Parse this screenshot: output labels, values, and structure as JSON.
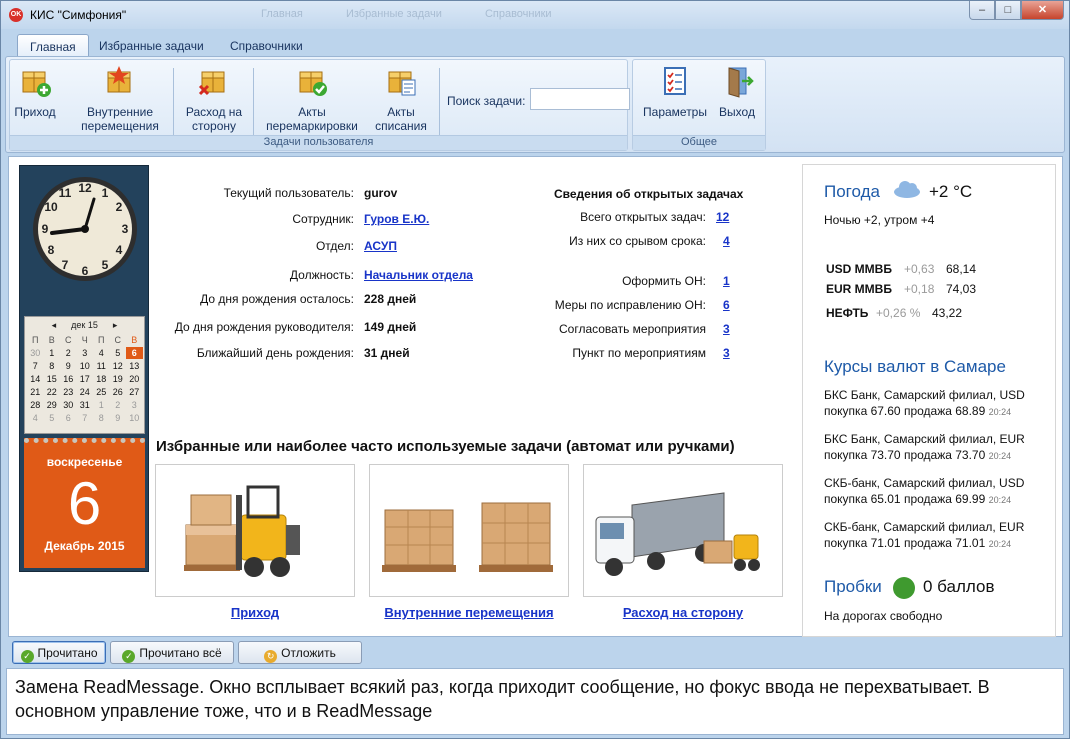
{
  "window": {
    "icon_text": "OK",
    "title": "КИС \"Симфония\"",
    "ghost_tabs": [
      "Главная",
      "Избранные задачи",
      "Справочники"
    ],
    "controls": {
      "minimize": "–",
      "maximize": "□",
      "close": "✕"
    }
  },
  "ribbon": {
    "tabs": [
      "Главная",
      "Избранные задачи",
      "Справочники"
    ],
    "buttons": {
      "income": [
        "Приход",
        ""
      ],
      "internal": [
        "Внутренние",
        "перемещения"
      ],
      "outgoing": [
        "Расход на",
        "сторону"
      ],
      "remark": [
        "Акты",
        "перемаркировки"
      ],
      "writeoff": [
        "Акты",
        "списания"
      ],
      "params": [
        "Параметры",
        ""
      ],
      "exit": [
        "Выход",
        ""
      ]
    },
    "search_label": "Поиск задачи:",
    "search_value": "",
    "group_user": "Задачи пользователя",
    "group_common": "Общее"
  },
  "calendar": {
    "month_label": "дек 15",
    "headers": [
      "П",
      "В",
      "С",
      "Ч",
      "П",
      "С",
      "В"
    ],
    "weeks": [
      [
        "30",
        "1",
        "2",
        "3",
        "4",
        "5",
        "6"
      ],
      [
        "7",
        "8",
        "9",
        "10",
        "11",
        "12",
        "13"
      ],
      [
        "14",
        "15",
        "16",
        "17",
        "18",
        "19",
        "20"
      ],
      [
        "21",
        "22",
        "23",
        "24",
        "25",
        "26",
        "27"
      ],
      [
        "28",
        "29",
        "30",
        "31",
        "1",
        "2",
        "3"
      ],
      [
        "4",
        "5",
        "6",
        "7",
        "8",
        "9",
        "10"
      ]
    ],
    "weekday": "воскресенье",
    "day": "6",
    "month_year": "Декабрь 2015"
  },
  "user_info": {
    "current_user_label": "Текущий пользователь:",
    "current_user": "gurov",
    "employee_label": "Сотрудник:",
    "employee": "Гуров Е.Ю.",
    "department_label": "Отдел:",
    "department": "АСУП",
    "position_label": "Должность:",
    "position": "Начальник отдела",
    "bday_label": "До дня рождения осталось:",
    "bday": "228 дней",
    "boss_bday_label": "До дня рождения руководителя:",
    "boss_bday": "149 дней",
    "next_bday_label": "Ближайший день рождения:",
    "next_bday": "31 дней"
  },
  "open_tasks": {
    "title": "Сведения об открытых задачах",
    "total_label": "Всего открытых задач:",
    "total": "12",
    "overdue_label": "Из них со срывом срока:",
    "overdue": "4",
    "on_label": "Оформить ОН:",
    "on": "1",
    "fix_label": "Меры по исправлению ОН:",
    "fix": "6",
    "agree_label": "Согласовать мероприятия",
    "agree": "3",
    "item_label": "Пункт по мероприятиям",
    "item": "3"
  },
  "favorites": {
    "title": "Избранные или наиболее часто используемые задачи (автомат или ручками)",
    "items": [
      "Приход",
      "Внутренние перемещения",
      "Расход на сторону"
    ]
  },
  "weather": {
    "title": "Погода",
    "temp": "+2 °C",
    "detail": "Ночью +2,  утром +4"
  },
  "stocks": [
    {
      "name": "USD ММВБ",
      "change": "+0,63",
      "value": "68,14"
    },
    {
      "name": "EUR ММВБ",
      "change": "+0,18",
      "value": "74,03"
    },
    {
      "name": "НЕФТЬ",
      "change": "+0,26 %",
      "value": "43,22"
    }
  ],
  "rates": {
    "title": "Курсы валют в Самаре",
    "items": [
      {
        "line1": "БКС Банк, Самарский филиал, USD",
        "line2": "покупка 67.60 продажа 68.89",
        "time": "20:24"
      },
      {
        "line1": "БКС Банк, Самарский филиал, EUR",
        "line2": "покупка 73.70 продажа 73.70",
        "time": "20:24"
      },
      {
        "line1": "СКБ-банк, Самарский филиал, USD",
        "line2": "покупка 65.01 продажа 69.99",
        "time": "20:24"
      },
      {
        "line1": "СКБ-банк, Самарский филиал, EUR",
        "line2": "покупка 71.01 продажа 71.01",
        "time": "20:24"
      }
    ]
  },
  "traffic": {
    "title": "Пробки",
    "score": "0 баллов",
    "detail": "На дорогах свободно"
  },
  "bottom": {
    "read": "Прочитано",
    "read_all": "Прочитано всё",
    "postpone": "Отложить",
    "message": "Замена ReadMessage. Окно всплывает всякий раз, когда приходит сообщение, но фокус ввода не перехватывает. В основном управление тоже, что и в ReadMessage"
  },
  "colors": {
    "accent": "#1e5aa8",
    "link": "#1834c8",
    "calendar_orange": "#e05a17",
    "ribbon_bg": "#d3e2f3"
  }
}
